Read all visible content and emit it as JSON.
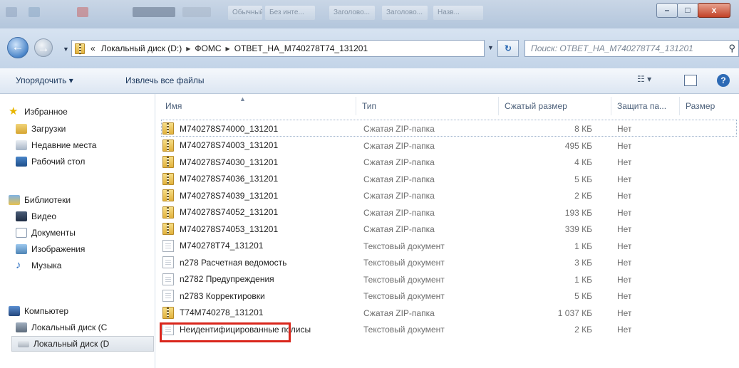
{
  "window": {
    "ribbon_styles": [
      "Обычный",
      "Без инте...",
      "Заголово...",
      "Заголово...",
      "Назв..."
    ],
    "controls": {
      "minimize": "–",
      "maximize": "□",
      "close": "x"
    }
  },
  "address": {
    "back_icon": "arrow-left-icon",
    "breadcrumbs": [
      "Локальный диск (D:)",
      "ФОМС",
      "ОТВЕТ_НА_M740278T74_131201"
    ],
    "overflow": "«",
    "search_placeholder": "Поиск: ОТВЕТ_НА_M740278T74_131201"
  },
  "toolbar": {
    "organize": "Упорядочить ▾",
    "extract_all": "Извлечь все файлы"
  },
  "nav": {
    "favorites": {
      "label": "Избранное",
      "items": [
        "Загрузки",
        "Недавние места",
        "Рабочий стол"
      ]
    },
    "libraries": {
      "label": "Библиотеки",
      "items": [
        "Видео",
        "Документы",
        "Изображения",
        "Музыка"
      ]
    },
    "computer": {
      "label": "Компьютер",
      "items": [
        "Локальный диск (C",
        "Локальный диск (D"
      ]
    }
  },
  "columns": [
    "Имя",
    "Тип",
    "Сжатый размер",
    "Защита па...",
    "Размер"
  ],
  "files": [
    {
      "name": "M740278S74000_131201",
      "type": "Сжатая ZIP-папка",
      "size": "8 КБ",
      "protected": "Нет",
      "icon": "zip"
    },
    {
      "name": "M740278S74003_131201",
      "type": "Сжатая ZIP-папка",
      "size": "495 КБ",
      "protected": "Нет",
      "icon": "zip"
    },
    {
      "name": "M740278S74030_131201",
      "type": "Сжатая ZIP-папка",
      "size": "4 КБ",
      "protected": "Нет",
      "icon": "zip"
    },
    {
      "name": "M740278S74036_131201",
      "type": "Сжатая ZIP-папка",
      "size": "5 КБ",
      "protected": "Нет",
      "icon": "zip"
    },
    {
      "name": "M740278S74039_131201",
      "type": "Сжатая ZIP-папка",
      "size": "2 КБ",
      "protected": "Нет",
      "icon": "zip"
    },
    {
      "name": "M740278S74052_131201",
      "type": "Сжатая ZIP-папка",
      "size": "193 КБ",
      "protected": "Нет",
      "icon": "zip"
    },
    {
      "name": "M740278S74053_131201",
      "type": "Сжатая ZIP-папка",
      "size": "339 КБ",
      "protected": "Нет",
      "icon": "zip"
    },
    {
      "name": "M740278T74_131201",
      "type": "Текстовый документ",
      "size": "1 КБ",
      "protected": "Нет",
      "icon": "txt"
    },
    {
      "name": "n278 Расчетная ведомость",
      "type": "Текстовый документ",
      "size": "3 КБ",
      "protected": "Нет",
      "icon": "txt"
    },
    {
      "name": "n2782 Предупреждения",
      "type": "Текстовый документ",
      "size": "1 КБ",
      "protected": "Нет",
      "icon": "txt"
    },
    {
      "name": "n2783 Корректировки",
      "type": "Текстовый документ",
      "size": "5 КБ",
      "protected": "Нет",
      "icon": "txt"
    },
    {
      "name": "T74M740278_131201",
      "type": "Сжатая ZIP-папка",
      "size": "1 037 КБ",
      "protected": "Нет",
      "icon": "zip"
    },
    {
      "name": "Неидентифицированные полисы",
      "type": "Текстовый документ",
      "size": "2 КБ",
      "protected": "Нет",
      "icon": "txt"
    }
  ],
  "colors": {
    "highlight": "#d9261c",
    "link_text": "#1e3a5f"
  }
}
